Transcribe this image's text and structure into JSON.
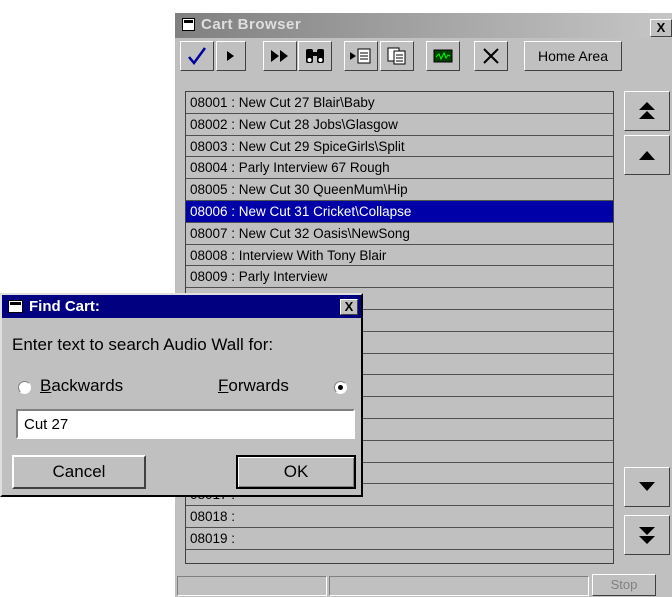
{
  "cart_browser": {
    "title": "Cart Browser",
    "close_glyph": "X",
    "toolbar": {
      "buttons": [
        "check-icon",
        "play-icon",
        "fast-forward-icon",
        "binoculars-icon",
        "insert-icon",
        "copy-icon",
        "waveform-icon",
        "delete-icon"
      ],
      "home_area_label": "Home Area"
    },
    "rows": [
      "08001 : New Cut 27 Blair\\Baby",
      "08002 : New Cut 28 Jobs\\Glasgow",
      "08003 : New Cut 29 SpiceGirls\\Split",
      "08004 : Parly Interview 67 Rough",
      "08005 : New Cut 30 QueenMum\\Hip",
      "08006 : New Cut 31 Cricket\\Collapse",
      "08007 : New Cut 32 Oasis\\NewSong",
      "08008 : Interview With Tony Blair",
      "08009 : Parly Interview",
      "",
      "",
      "",
      "",
      "",
      "",
      "",
      "",
      "",
      "08017 :",
      "08018 :",
      "08019 :"
    ],
    "selected_index": 5,
    "stop_label": "Stop"
  },
  "find_dialog": {
    "title": "Find Cart:",
    "close_glyph": "X",
    "prompt": "Enter text to search Audio Wall for:",
    "backwards_label": "Backwards",
    "forwards_label": "Forwards",
    "direction": "forwards",
    "search_value": "Cut 27",
    "cancel_label": "Cancel",
    "ok_label": "OK"
  }
}
